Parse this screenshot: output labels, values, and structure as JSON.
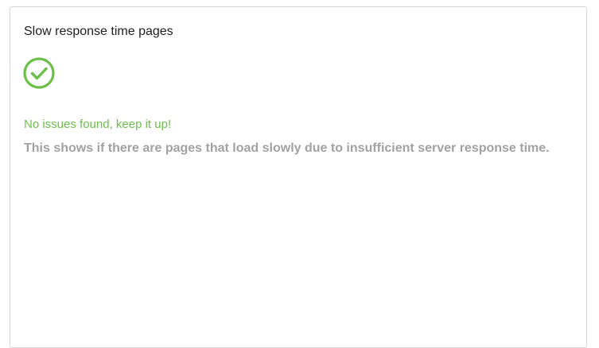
{
  "card": {
    "title": "Slow response time pages",
    "status_icon": "check-circle-icon",
    "status_message": "No issues found, keep it up!",
    "description": "This shows if there are pages that load slowly due to insufficient server response time."
  },
  "colors": {
    "success": "#6cc04a",
    "title": "#1f1f1f",
    "description": "#a2a2a2",
    "border": "#d6d6d6"
  }
}
